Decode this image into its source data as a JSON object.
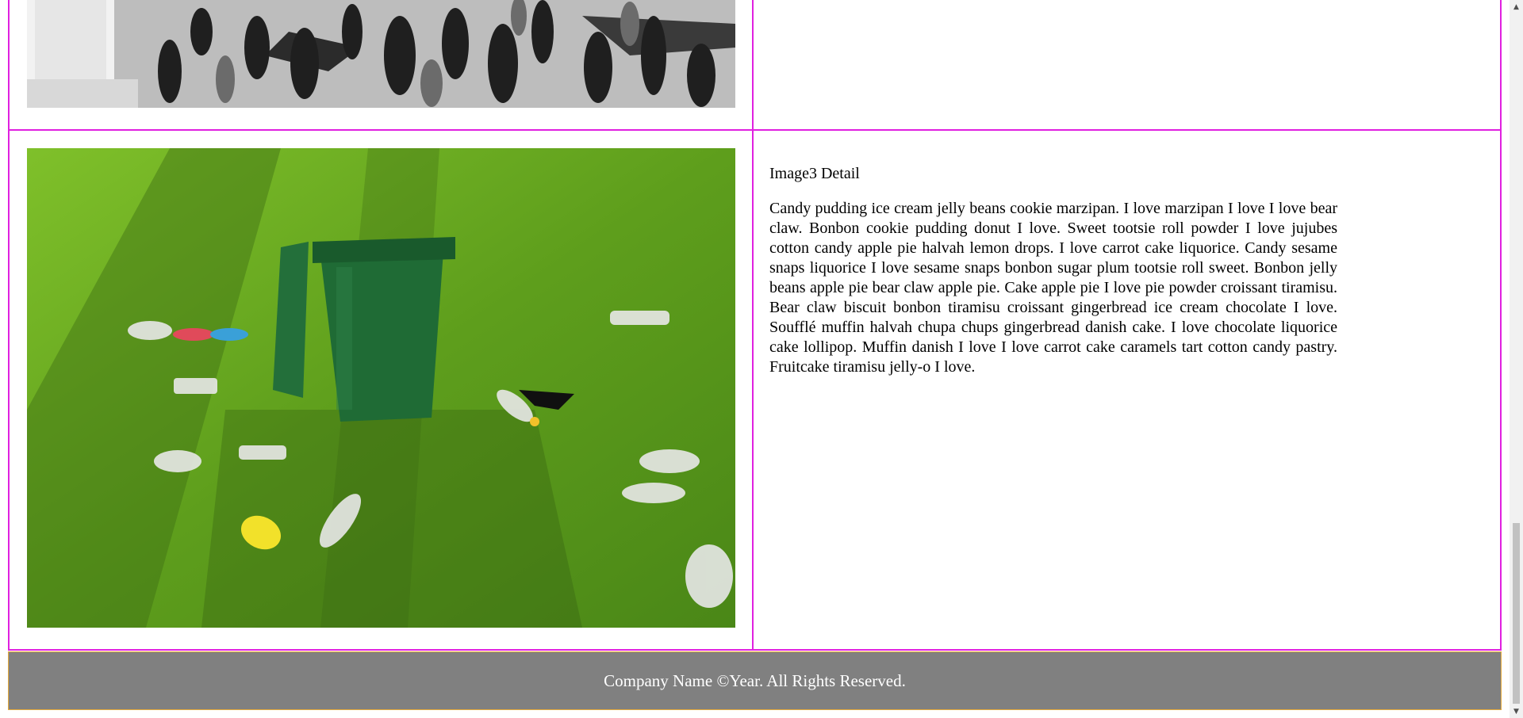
{
  "images": [
    {
      "alt": "Crowd of people walking, black and white"
    },
    {
      "alt": "Green trash bin on grass surrounded by litter"
    }
  ],
  "detail": {
    "title": "Image3 Detail",
    "body": "Candy pudding ice cream jelly beans cookie marzipan. I love marzipan I love I love bear claw. Bonbon cookie pudding donut I love. Sweet tootsie roll powder I love jujubes cotton candy apple pie halvah lemon drops. I love carrot cake liquorice. Candy sesame snaps liquorice I love sesame snaps bonbon sugar plum tootsie roll sweet. Bonbon jelly beans apple pie bear claw apple pie. Cake apple pie I love pie powder croissant tiramisu. Bear claw biscuit bonbon tiramisu croissant gingerbread ice cream chocolate I love. Soufflé muffin halvah chupa chups gingerbread danish cake. I love chocolate liquorice cake lollipop. Muffin danish I love I love carrot cake caramels tart cotton candy pastry. Fruitcake tiramisu jelly-o I love."
  },
  "footer": {
    "text": "Company Name ©Year. All Rights Reserved."
  },
  "scrollbar": {
    "up_icon": "triangle-up",
    "down_icon": "triangle-down",
    "up_glyph": "▲",
    "down_glyph": "▼"
  },
  "colors": {
    "table_border": "#e020e0",
    "footer_bg": "#808080",
    "footer_border": "#e5a93a",
    "footer_text": "#ffffff"
  }
}
